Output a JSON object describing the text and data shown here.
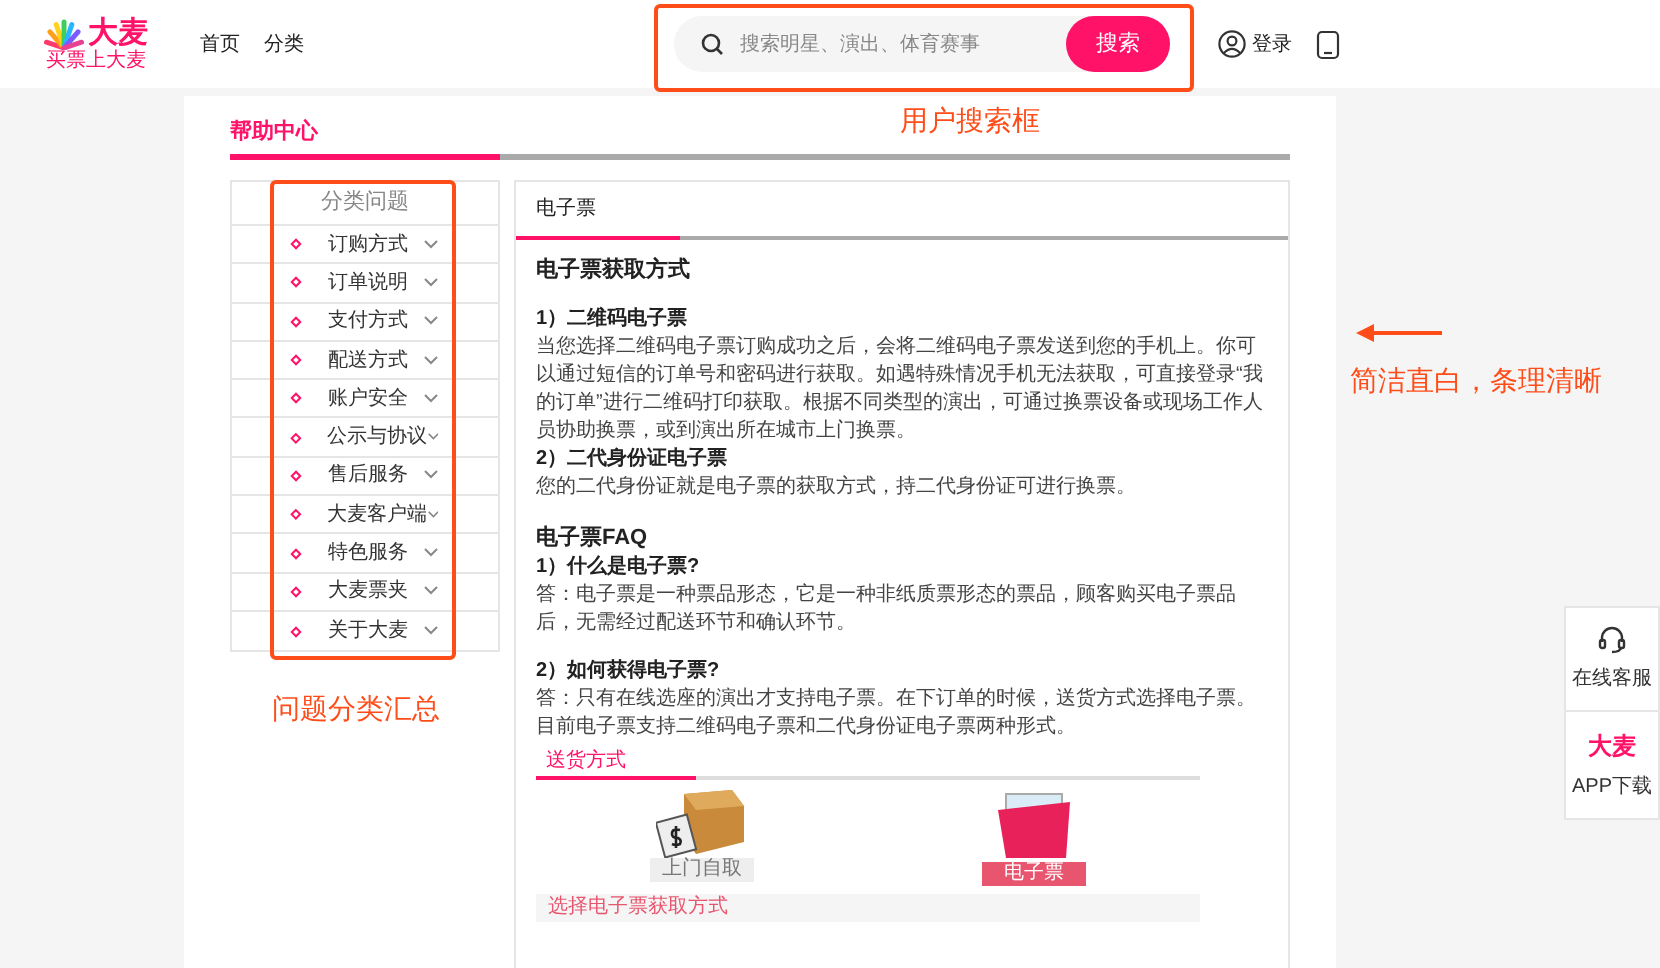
{
  "header": {
    "logo": {
      "name": "大麦",
      "slogan": "买票上大麦"
    },
    "nav": [
      {
        "label": "首页"
      },
      {
        "label": "分类"
      }
    ],
    "search": {
      "placeholder": "搜索明星、演出、体育赛事",
      "button": "搜索"
    },
    "login": "登录"
  },
  "help_center": {
    "title": "帮助中心"
  },
  "sidebar": {
    "title": "分类问题",
    "items": [
      {
        "label": "订购方式"
      },
      {
        "label": "订单说明"
      },
      {
        "label": "支付方式"
      },
      {
        "label": "配送方式"
      },
      {
        "label": "账户安全"
      },
      {
        "label": "公示与协议"
      },
      {
        "label": "售后服务"
      },
      {
        "label": "大麦客户端"
      },
      {
        "label": "特色服务"
      },
      {
        "label": "大麦票夹"
      },
      {
        "label": "关于大麦"
      }
    ]
  },
  "content": {
    "tab": "电子票",
    "blocks": [
      {
        "kind": "title",
        "text": "电子票获取方式"
      },
      {
        "kind": "gap"
      },
      {
        "kind": "heading",
        "text": "1）二维码电子票"
      },
      {
        "kind": "para",
        "text": "当您选择二维码电子票订购成功之后，会将二维码电子票发送到您的手机上。你可以通过短信的订单号和密码进行获取。如遇特殊情况手机无法获取，可直接登录“我的订单”进行二维码打印获取。根据不同类型的演出，可通过换票设备或现场工作人员协助换票，或到演出所在城市上门换票。"
      },
      {
        "kind": "heading",
        "text": "2）二代身份证电子票"
      },
      {
        "kind": "para",
        "text": "您的二代身份证就是电子票的获取方式，持二代身份证可进行换票。"
      },
      {
        "kind": "gap"
      },
      {
        "kind": "title",
        "text": "电子票FAQ"
      },
      {
        "kind": "heading",
        "text": "1）什么是电子票?"
      },
      {
        "kind": "para",
        "text": "答：电子票是一种票品形态，它是一种非纸质票形态的票品，顾客购买电子票品后，无需经过配送环节和确认环节。"
      },
      {
        "kind": "gap"
      },
      {
        "kind": "heading",
        "text": "2）如何获得电子票?"
      },
      {
        "kind": "para",
        "text": "答：只有在线选座的演出才支持电子票。在下订单的时候，送货方式选择电子票。目前电子票支持二维码电子票和二代身份证电子票两种形式。"
      }
    ],
    "figure": {
      "tab": "送货方式",
      "options": [
        {
          "kind": "box",
          "label": "上门自取",
          "selected": false
        },
        {
          "kind": "folder",
          "label": "电子票",
          "selected": true
        }
      ],
      "footer": "选择电子票获取方式"
    }
  },
  "float_bar": {
    "items": [
      {
        "kind": "service",
        "label": "在线客服"
      },
      {
        "kind": "app",
        "logo": "大麦",
        "label": "APP下载"
      }
    ]
  },
  "annotations": [
    {
      "kind": "search",
      "text": "用户搜索框"
    },
    {
      "kind": "content",
      "text": "简洁直白，条理清晰"
    },
    {
      "kind": "sidebar",
      "text": "问题分类汇总"
    }
  ]
}
